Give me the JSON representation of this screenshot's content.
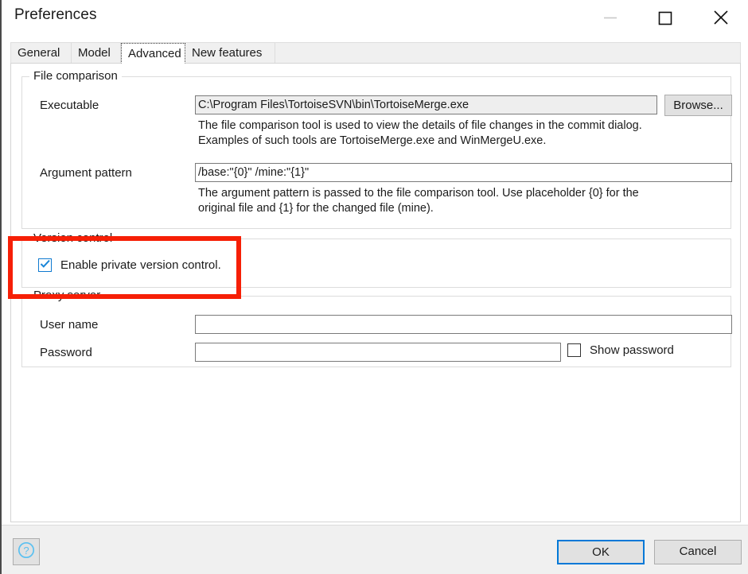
{
  "window": {
    "title": "Preferences",
    "controls": {
      "minimize": "minimize-icon",
      "maximize": "maximize-icon",
      "close": "close-icon"
    }
  },
  "tabs": [
    {
      "label": "General",
      "selected": false
    },
    {
      "label": "Model",
      "selected": false
    },
    {
      "label": "Advanced",
      "selected": true
    },
    {
      "label": "New features",
      "selected": false
    }
  ],
  "file_comparison": {
    "group_title": "File comparison",
    "executable_label": "Executable",
    "executable_value": "C:\\Program Files\\TortoiseSVN\\bin\\TortoiseMerge.exe",
    "browse_label": "Browse...",
    "executable_help": "The file comparison tool is used to view the details of file changes in the commit dialog.\nExamples of such tools are TortoiseMerge.exe and WinMergeU.exe.",
    "argument_label": "Argument pattern",
    "argument_value": "/base:\"{0}\" /mine:\"{1}\"",
    "argument_help": "The argument pattern is passed to the file comparison tool. Use placeholder {0} for the\noriginal file and {1} for the changed file (mine)."
  },
  "version_control": {
    "group_title": "Version control",
    "enable_label": "Enable private version control.",
    "enable_checked": true
  },
  "proxy_server": {
    "group_title": "Proxy server",
    "username_label": "User name",
    "username_value": "",
    "password_label": "Password",
    "password_value": "",
    "show_password_label": "Show password",
    "show_password_checked": false
  },
  "footer": {
    "help_icon": "question-mark-icon",
    "ok_label": "OK",
    "cancel_label": "Cancel"
  },
  "annotation": {
    "color": "#f61f06",
    "target": "version-control-group"
  }
}
